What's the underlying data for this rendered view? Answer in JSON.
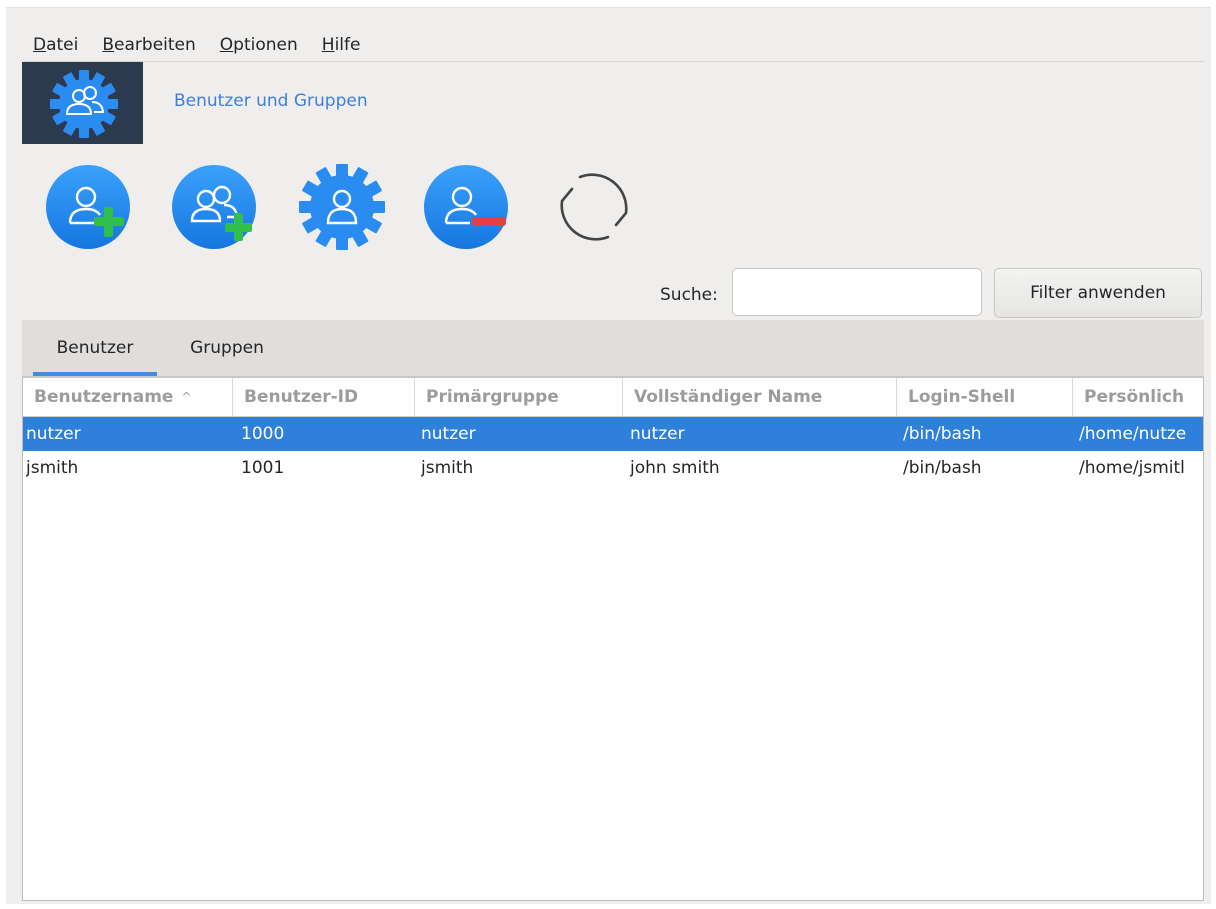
{
  "menubar": {
    "items": [
      {
        "label": "Datei",
        "mnemonic": "D",
        "rest": "atei"
      },
      {
        "label": "Bearbeiten",
        "mnemonic": "B",
        "rest": "earbeiten"
      },
      {
        "label": "Optionen",
        "mnemonic": "O",
        "rest": "ptionen"
      },
      {
        "label": "Hilfe",
        "mnemonic": "H",
        "rest": "ilfe"
      }
    ]
  },
  "header": {
    "title": "Benutzer und Gruppen",
    "icon": "users-gear-icon"
  },
  "toolbar": {
    "buttons": [
      {
        "icon": "add-user-icon"
      },
      {
        "icon": "add-group-icon"
      },
      {
        "icon": "user-settings-gear-icon"
      },
      {
        "icon": "remove-user-icon"
      },
      {
        "icon": "refresh-icon"
      }
    ]
  },
  "search": {
    "label": "Suche:",
    "value": "",
    "button_label": "Filter anwenden"
  },
  "tabs": [
    {
      "label": "Benutzer",
      "active": true
    },
    {
      "label": "Gruppen",
      "active": false
    }
  ],
  "table": {
    "columns": [
      "Benutzername",
      "Benutzer-ID",
      "Primärgruppe",
      "Vollständiger Name",
      "Login-Shell",
      "Persönlich"
    ],
    "sort_indicator": "^",
    "rows": [
      [
        "nutzer",
        "1000",
        "nutzer",
        "nutzer",
        "/bin/bash",
        "/home/nutze"
      ],
      [
        "jsmith",
        "1001",
        "jsmith",
        "john smith",
        "/bin/bash",
        "/home/jsmitl"
      ]
    ],
    "selected_row": 0
  },
  "colors": {
    "accent": "#3d8ee0",
    "selection": "#2f80da",
    "header_bg": "#2c3a4f",
    "title_link": "#3f7fd9",
    "icon_blue": "#2a8cf0",
    "add_green": "#2fbf4a",
    "remove_red": "#e0404a"
  }
}
